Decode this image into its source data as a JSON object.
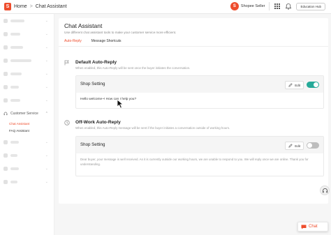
{
  "header": {
    "logo": "S",
    "home": "Home",
    "separator": ">",
    "page": "Chat Assistant",
    "shop_avatar": "S",
    "shop_name": "Shopee Seller",
    "education": "Education Hub"
  },
  "sidebar": {
    "section_label": "Customer Service",
    "sub_items": [
      "Chat Assistant",
      "FAQ Assistant"
    ]
  },
  "main": {
    "title": "Chat Assistant",
    "description": "Use different chat assistant tools to make your customer service more efficient.",
    "tabs": [
      "Auto-Reply",
      "Message Shortcuts"
    ]
  },
  "default_reply": {
    "title": "Default Auto-Reply",
    "description": "When enabled, this Auto-Reply will be sent once the buyer initiates the conversation.",
    "card_title": "Shop Setting",
    "edit_label": "Edit",
    "enabled": true,
    "message": "Hello welcome~! How can I help you?"
  },
  "offwork_reply": {
    "title": "Off-Work Auto-Reply",
    "description": "When enabled, this Auto-Reply message will be sent if the buyer initiates a conversation outside of working hours.",
    "card_title": "Shop Setting",
    "edit_label": "Edit",
    "enabled": false,
    "message": "Dear buyer, your message is well received. As it is currently outside our working hours, we are unable to respond to you. We will reply once we are online. Thank you for understanding."
  },
  "chat_button": {
    "label": "Chat"
  },
  "colors": {
    "accent": "#ee4d2d",
    "toggle_on": "#26aa99",
    "toggle_off": "#bdbdbd"
  }
}
